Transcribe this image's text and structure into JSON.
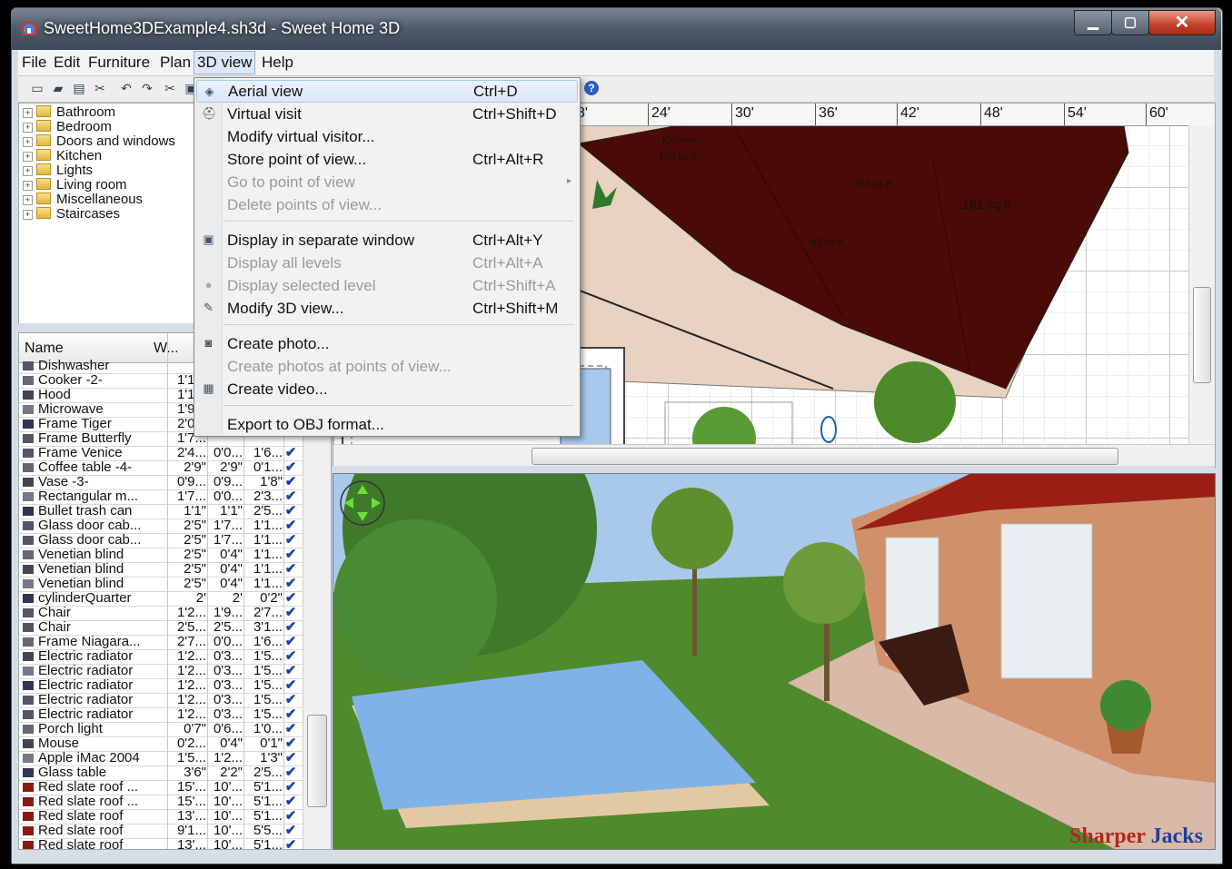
{
  "window": {
    "title": "SweetHome3DExample4.sh3d - Sweet Home 3D",
    "close_glyph": "✕",
    "max_glyph": "▢",
    "min_glyph": "▁"
  },
  "menubar": {
    "items": [
      "File",
      "Edit",
      "Furniture",
      "Plan",
      "3D view",
      "Help"
    ],
    "active": "3D view"
  },
  "toolbar": {
    "icons": [
      "new-file-icon",
      "open-folder-icon",
      "save-icon",
      "cut-tools-icon",
      "undo-icon",
      "redo-icon",
      "cut-icon",
      "copy-icon",
      "help-icon"
    ],
    "help_glyph": "?"
  },
  "catalog": {
    "categories": [
      "Bathroom",
      "Bedroom",
      "Doors and windows",
      "Kitchen",
      "Lights",
      "Living room",
      "Miscellaneous",
      "Staircases"
    ],
    "expander": "+"
  },
  "furniture": {
    "columns": [
      "Name",
      "W..."
    ],
    "rows": [
      {
        "name": "Dishwasher",
        "w": "",
        "d": "",
        "h": ""
      },
      {
        "name": "Cooker -2-",
        "w": "1'1...",
        "d": "",
        "h": ""
      },
      {
        "name": "Hood",
        "w": "1'1...",
        "d": "",
        "h": ""
      },
      {
        "name": "Microwave",
        "w": "1'9...",
        "d": "",
        "h": ""
      },
      {
        "name": "Frame Tiger",
        "w": "2'0...",
        "d": "",
        "h": ""
      },
      {
        "name": "Frame Butterfly",
        "w": "1'7...",
        "d": "",
        "h": ""
      },
      {
        "name": "Frame Venice",
        "w": "2'4...",
        "d": "0'0...",
        "h": "1'6..."
      },
      {
        "name": "Coffee table -4-",
        "w": "2'9\"",
        "d": "2'9\"",
        "h": "0'1..."
      },
      {
        "name": "Vase -3-",
        "w": "0'9...",
        "d": "0'9...",
        "h": "1'8\""
      },
      {
        "name": "Rectangular m...",
        "w": "1'7...",
        "d": "0'0...",
        "h": "2'3..."
      },
      {
        "name": "Bullet trash can",
        "w": "1'1\"",
        "d": "1'1\"",
        "h": "2'5..."
      },
      {
        "name": "Glass door cab...",
        "w": "2'5\"",
        "d": "1'7...",
        "h": "1'1..."
      },
      {
        "name": "Glass door cab...",
        "w": "2'5\"",
        "d": "1'7...",
        "h": "1'1..."
      },
      {
        "name": "Venetian blind",
        "w": "2'5\"",
        "d": "0'4\"",
        "h": "1'1..."
      },
      {
        "name": "Venetian blind",
        "w": "2'5\"",
        "d": "0'4\"",
        "h": "1'1..."
      },
      {
        "name": "Venetian blind",
        "w": "2'5\"",
        "d": "0'4\"",
        "h": "1'1..."
      },
      {
        "name": "cylinderQuarter",
        "w": "2'",
        "d": "2'",
        "h": "0'2\""
      },
      {
        "name": "Chair",
        "w": "1'2...",
        "d": "1'9...",
        "h": "2'7..."
      },
      {
        "name": "Chair",
        "w": "2'5...",
        "d": "2'5...",
        "h": "3'1..."
      },
      {
        "name": "Frame Niagara...",
        "w": "2'7...",
        "d": "0'0...",
        "h": "1'6..."
      },
      {
        "name": "Electric radiator",
        "w": "1'2...",
        "d": "0'3...",
        "h": "1'5..."
      },
      {
        "name": "Electric radiator",
        "w": "1'2...",
        "d": "0'3...",
        "h": "1'5..."
      },
      {
        "name": "Electric radiator",
        "w": "1'2...",
        "d": "0'3...",
        "h": "1'5..."
      },
      {
        "name": "Electric radiator",
        "w": "1'2...",
        "d": "0'3...",
        "h": "1'5..."
      },
      {
        "name": "Electric radiator",
        "w": "1'2...",
        "d": "0'3...",
        "h": "1'5..."
      },
      {
        "name": "Porch light",
        "w": "0'7\"",
        "d": "0'6...",
        "h": "1'0..."
      },
      {
        "name": "Mouse",
        "w": "0'2...",
        "d": "0'4\"",
        "h": "0'1\""
      },
      {
        "name": "Apple iMac 2004",
        "w": "1'5...",
        "d": "1'2...",
        "h": "1'3\""
      },
      {
        "name": "Glass table",
        "w": "3'6\"",
        "d": "2'2\"",
        "h": "2'5..."
      },
      {
        "name": "Red slate roof ...",
        "w": "15'...",
        "d": "10'...",
        "h": "5'1..."
      },
      {
        "name": "Red slate roof ...",
        "w": "15'...",
        "d": "10'...",
        "h": "5'1..."
      },
      {
        "name": "Red slate roof",
        "w": "13'...",
        "d": "10'...",
        "h": "5'1..."
      },
      {
        "name": "Red slate roof",
        "w": "9'1...",
        "d": "10'...",
        "h": "5'5..."
      },
      {
        "name": "Red slate roof",
        "w": "13'...",
        "d": "10'...",
        "h": "5'1..."
      }
    ],
    "check_glyph": "✔"
  },
  "plan": {
    "ruler_labels": [
      "8'",
      "24'",
      "30'",
      "36'",
      "42'",
      "48'",
      "54'",
      "60'"
    ],
    "room_labels": [
      "Kitchen",
      "100 sq ft",
      "172 sq ft",
      "161 sq ft",
      "43 sq ft"
    ]
  },
  "menu_3dview": {
    "items": [
      {
        "label": "Aerial view",
        "shortcut": "Ctrl+D",
        "enabled": true,
        "icon": "aerial-view-icon",
        "highlighted": true
      },
      {
        "label": "Virtual visit",
        "shortcut": "Ctrl+Shift+D",
        "enabled": true,
        "icon": "virtual-visitor-icon"
      },
      {
        "label": "Modify virtual visitor...",
        "shortcut": "",
        "enabled": true
      },
      {
        "label": "Store point of view...",
        "shortcut": "Ctrl+Alt+R",
        "enabled": true
      },
      {
        "label": "Go to point of view",
        "shortcut": "",
        "enabled": false,
        "submenu": true
      },
      {
        "label": "Delete points of view...",
        "shortcut": "",
        "enabled": false
      },
      {
        "label": "Display in separate window",
        "shortcut": "Ctrl+Alt+Y",
        "enabled": true,
        "icon": "window-icon"
      },
      {
        "label": "Display all levels",
        "shortcut": "Ctrl+Alt+A",
        "enabled": false
      },
      {
        "label": "Display selected level",
        "shortcut": "Ctrl+Shift+A",
        "enabled": false,
        "icon": "radio-icon"
      },
      {
        "label": "Modify 3D view...",
        "shortcut": "Ctrl+Shift+M",
        "enabled": true,
        "icon": "modify-3d-icon"
      },
      {
        "label": "Create photo...",
        "shortcut": "",
        "enabled": true,
        "icon": "camera-icon"
      },
      {
        "label": "Create photos at points of view...",
        "shortcut": "",
        "enabled": false
      },
      {
        "label": "Create video...",
        "shortcut": "",
        "enabled": true,
        "icon": "video-camera-icon"
      },
      {
        "label": "Export to OBJ format...",
        "shortcut": "",
        "enabled": true
      }
    ],
    "submenu_arrow": "▸"
  },
  "watermark": {
    "word1": "Sharper",
    "word2": "Jacks",
    "color1": "#b3261e",
    "color2": "#1f3f9a"
  },
  "colors": {
    "roof": "#4a0a06",
    "terrace": "#e8d3c2",
    "pool": "#7fb3e8",
    "grass": "#4f8a2c",
    "sky": "#a9c9ea",
    "brick": "#d0906a"
  }
}
